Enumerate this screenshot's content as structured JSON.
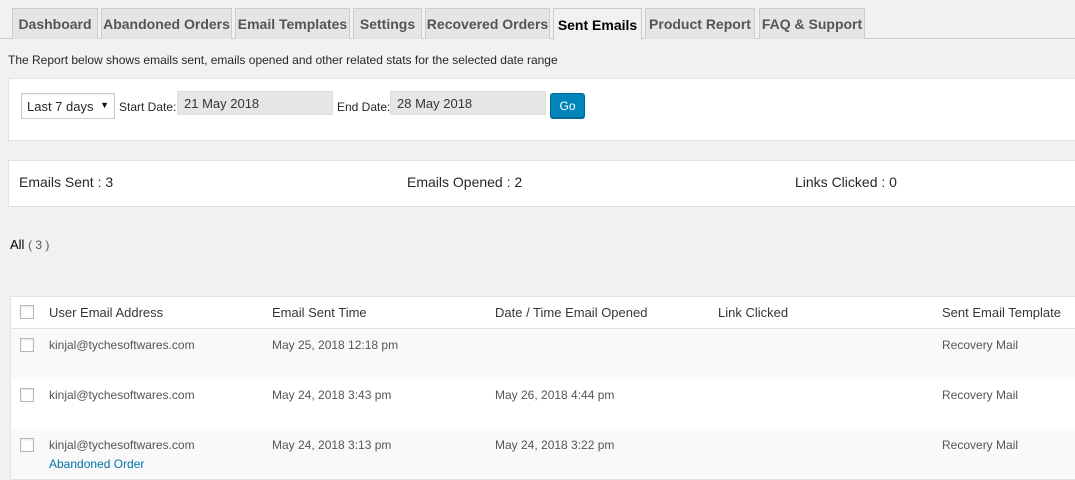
{
  "tabs": [
    {
      "label": "Dashboard",
      "active": false
    },
    {
      "label": "Abandoned Orders",
      "active": false
    },
    {
      "label": "Email Templates",
      "active": false
    },
    {
      "label": "Settings",
      "active": false
    },
    {
      "label": "Recovered Orders",
      "active": false
    },
    {
      "label": "Sent Emails",
      "active": true
    },
    {
      "label": "Product Report",
      "active": false
    },
    {
      "label": "FAQ & Support",
      "active": false
    }
  ],
  "intro_text": "The Report below shows emails sent, emails opened and other related stats for the selected date range",
  "filter": {
    "range_selected": "Last 7 days",
    "start_label": "Start Date:",
    "start_value": "21 May 2018",
    "end_label": "End Date:",
    "end_value": "28 May 2018",
    "go_label": "Go"
  },
  "stats": {
    "sent_label": "Emails Sent :",
    "sent_value": "3",
    "opened_label": "Emails Opened :",
    "opened_value": "2",
    "clicked_label": "Links Clicked :",
    "clicked_value": "0"
  },
  "view_filter": {
    "label": "All",
    "count": "( 3 )"
  },
  "table": {
    "columns": [
      "User Email Address",
      "Email Sent Time",
      "Date / Time Email Opened",
      "Link Clicked",
      "Sent Email Template"
    ],
    "rows": [
      {
        "email": "kinjal@tychesoftwares.com",
        "sent": "May 25, 2018 12:18 pm",
        "opened": "",
        "link": "",
        "template": "Recovery Mail",
        "action": ""
      },
      {
        "email": "kinjal@tychesoftwares.com",
        "sent": "May 24, 2018 3:43 pm",
        "opened": "May 26, 2018 4:44 pm",
        "link": "",
        "template": "Recovery Mail",
        "action": ""
      },
      {
        "email": "kinjal@tychesoftwares.com",
        "sent": "May 24, 2018 3:13 pm",
        "opened": "May 24, 2018 3:22 pm",
        "link": "",
        "template": "Recovery Mail",
        "action": "Abandoned Order"
      }
    ]
  },
  "colors": {
    "accent": "#0085ba",
    "link": "#0073aa",
    "background": "#f1f1f1"
  }
}
